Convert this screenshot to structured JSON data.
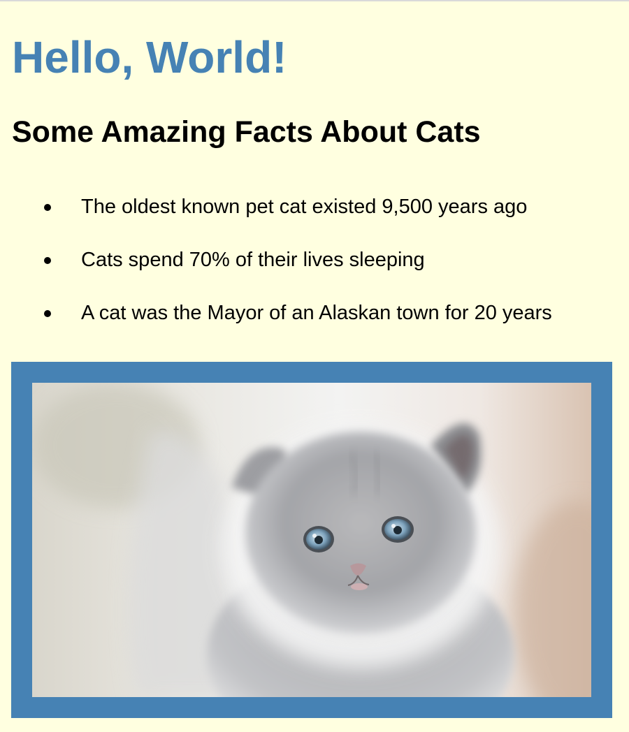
{
  "page": {
    "title": "Hello, World!",
    "subtitle": "Some Amazing Facts About Cats",
    "facts": [
      "The oldest known pet cat existed 9,500 years ago",
      "Cats spend 70% of their lives sleeping",
      "A cat was the Mayor of an Alaskan town for 20 years"
    ]
  },
  "colors": {
    "background": "#ffffe0",
    "accent": "#4682b4",
    "text": "#000000"
  },
  "image": {
    "subject": "gray-kitten-photo"
  }
}
